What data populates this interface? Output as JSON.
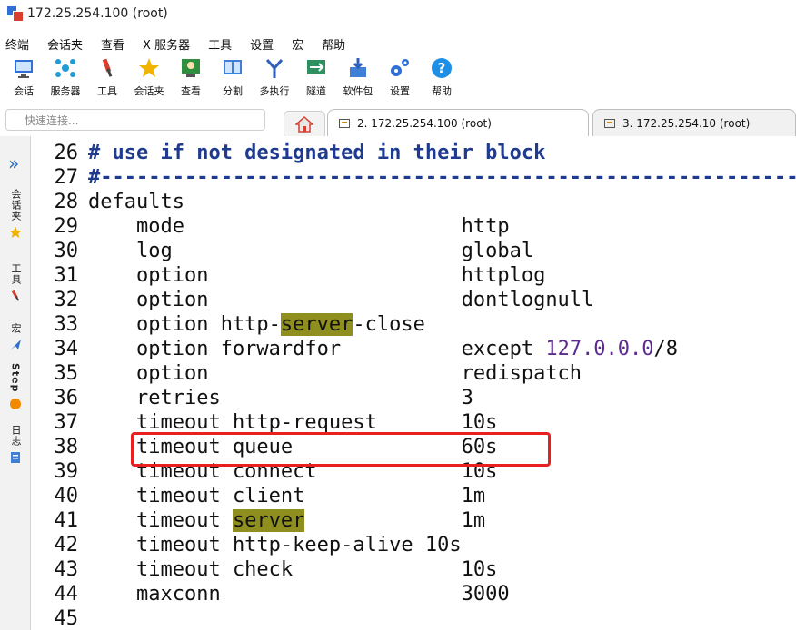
{
  "window": {
    "title": "172.25.254.100 (root)"
  },
  "menu": [
    "终端",
    "会话夹",
    "查看",
    "X 服务器",
    "工具",
    "设置",
    "宏",
    "帮助"
  ],
  "toolbar": [
    {
      "label": "会话",
      "icon": "session-monitor-icon",
      "color": "#2f6fd6"
    },
    {
      "label": "服务器",
      "icon": "servers-network-icon",
      "color": "#1f9bd6"
    },
    {
      "label": "工具",
      "icon": "tools-icon",
      "color": "#d6402f"
    },
    {
      "label": "会话夹",
      "icon": "star-icon",
      "color": "#f0b400"
    },
    {
      "label": "查看",
      "icon": "view-person-icon",
      "color": "#2f8f3f"
    },
    {
      "label": "分割",
      "icon": "split-window-icon",
      "color": "#3f7fd6"
    },
    {
      "label": "多执行",
      "icon": "multi-exec-fork-icon",
      "color": "#2f5fb6"
    },
    {
      "label": "隧道",
      "icon": "tunnel-icon",
      "color": "#2f8f5f"
    },
    {
      "label": "软件包",
      "icon": "package-download-icon",
      "color": "#3f7fd6"
    },
    {
      "label": "设置",
      "icon": "settings-gears-icon",
      "color": "#2f6fd6"
    },
    {
      "label": "帮助",
      "icon": "help-icon",
      "color": "#1f8fe6"
    }
  ],
  "quick_connect": {
    "placeholder": "快速连接..."
  },
  "tabs": [
    {
      "label": "2. 172.25.254.100 (root)",
      "active": true
    },
    {
      "label": "3. 172.25.254.10 (root)",
      "active": false
    }
  ],
  "sidebar": [
    {
      "label": "会话夹",
      "icon": "star-icon"
    },
    {
      "label": "工具",
      "icon": "tools-icon"
    },
    {
      "label": "宏",
      "icon": "macro-arrow-icon"
    },
    {
      "label": "Step",
      "icon": "step-icon"
    },
    {
      "label": "日志",
      "icon": "log-icon"
    }
  ],
  "terminal": {
    "lines": [
      {
        "n": "26",
        "parts": [
          {
            "t": "# use if not designated in their block",
            "s": "comment"
          }
        ]
      },
      {
        "n": "27",
        "parts": [
          {
            "t": "#---------------------------------------------------------------",
            "s": "comment"
          }
        ]
      },
      {
        "n": "28",
        "parts": [
          {
            "t": "defaults",
            "s": ""
          }
        ]
      },
      {
        "n": "29",
        "parts": [
          {
            "t": "    mode                       http",
            "s": ""
          }
        ]
      },
      {
        "n": "30",
        "parts": [
          {
            "t": "    log                        global",
            "s": ""
          }
        ]
      },
      {
        "n": "31",
        "parts": [
          {
            "t": "    option                     httplog",
            "s": ""
          }
        ]
      },
      {
        "n": "32",
        "parts": [
          {
            "t": "    option                     dontlognull",
            "s": ""
          }
        ]
      },
      {
        "n": "33",
        "parts": [
          {
            "t": "    option http-",
            "s": ""
          },
          {
            "t": "server",
            "s": "hl"
          },
          {
            "t": "-close",
            "s": ""
          }
        ]
      },
      {
        "n": "34",
        "parts": [
          {
            "t": "    option forwardfor          except ",
            "s": ""
          },
          {
            "t": "127.0.0.0",
            "s": "num"
          },
          {
            "t": "/8",
            "s": ""
          }
        ]
      },
      {
        "n": "35",
        "parts": [
          {
            "t": "    option                     redispatch",
            "s": ""
          }
        ]
      },
      {
        "n": "36",
        "parts": [
          {
            "t": "    retries                    3",
            "s": ""
          }
        ]
      },
      {
        "n": "37",
        "parts": [
          {
            "t": "    timeout http-request       10s",
            "s": ""
          }
        ]
      },
      {
        "n": "38",
        "parts": [
          {
            "t": "    timeout queue              60s",
            "s": ""
          }
        ]
      },
      {
        "n": "39",
        "parts": [
          {
            "t": "    timeout connect            10s",
            "s": ""
          }
        ]
      },
      {
        "n": "40",
        "parts": [
          {
            "t": "    timeout client             1m",
            "s": ""
          }
        ]
      },
      {
        "n": "41",
        "parts": [
          {
            "t": "    timeout ",
            "s": ""
          },
          {
            "t": "server",
            "s": "hl"
          },
          {
            "t": "             1m",
            "s": ""
          }
        ]
      },
      {
        "n": "42",
        "parts": [
          {
            "t": "    timeout http-keep-alive 10s",
            "s": ""
          }
        ]
      },
      {
        "n": "43",
        "parts": [
          {
            "t": "    timeout check              10s",
            "s": ""
          }
        ]
      },
      {
        "n": "44",
        "parts": [
          {
            "t": "    maxconn                    3000",
            "s": ""
          }
        ]
      },
      {
        "n": "45",
        "parts": [
          {
            "t": "",
            "s": ""
          }
        ]
      }
    ]
  },
  "annotation": {
    "highlighted_line": "38",
    "color": "#e82020"
  }
}
